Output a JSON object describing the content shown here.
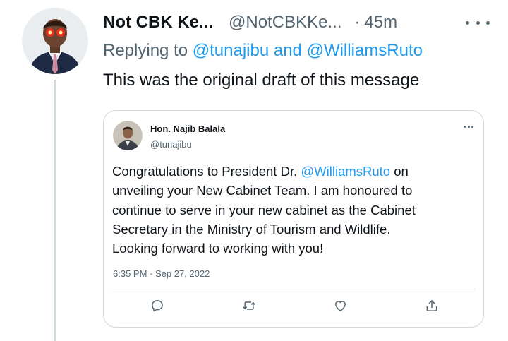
{
  "tweet": {
    "display_name": "Not CBK Ke...",
    "handle": "@NotCBKKe...",
    "separator": "·",
    "time": "45m",
    "replying_prefix": "Replying to",
    "replying_user1": "@tunajibu",
    "replying_and": "and",
    "replying_user2": "@WilliamsRuto",
    "text": "This was the original draft of this message",
    "more_icon": "more-icon"
  },
  "quoted": {
    "name": "Hon. Najib Balala",
    "handle": "@tunajibu",
    "body": {
      "line1_a": "Congratulations to President Dr. ",
      "line1_mention": "@WilliamsRuto",
      "line1_b": " on",
      "line2": "unveiling your New Cabinet Team. I am honoured to",
      "line3": "continue to serve in your new cabinet as the Cabinet",
      "line4": "Secretary in the Ministry of Tourism and Wildlife.",
      "line5": "Looking forward to working with you!"
    },
    "timestamp": "6:35 PM · Sep 27, 2022",
    "actions": [
      "reply-icon",
      "retweet-icon",
      "like-icon",
      "share-icon"
    ]
  },
  "colors": {
    "link": "#1d9bf0",
    "muted": "#536471",
    "text": "#0f1419",
    "border": "#cfd9de"
  }
}
